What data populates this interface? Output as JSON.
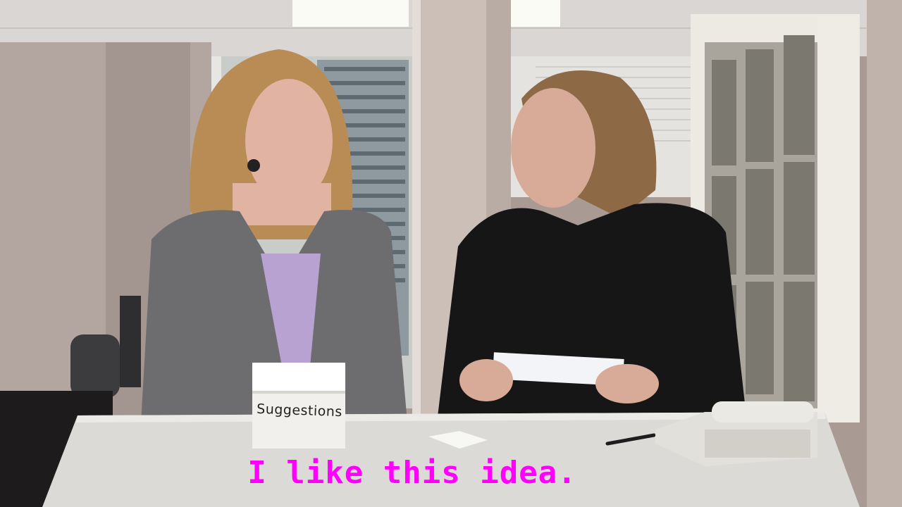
{
  "scene": {
    "box_label": "Suggestions",
    "caption": "I like this idea."
  },
  "colors": {
    "caption": "#ff00ff",
    "wall": "#b3a59f",
    "table": "#dcdad6",
    "jacket_gray": "#6d6d70",
    "blouse_lavender": "#b7a2d2",
    "jacket_black": "#161616"
  }
}
